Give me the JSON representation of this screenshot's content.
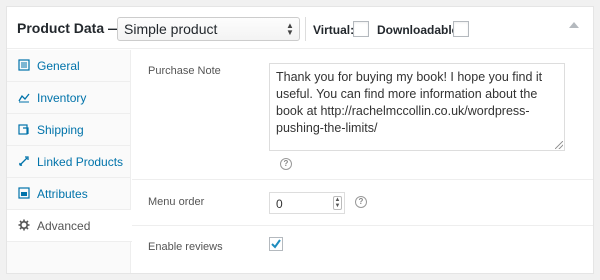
{
  "header": {
    "title": "Product Data —",
    "product_type": "Simple product",
    "virtual_label": "Virtual:",
    "downloadable_label": "Downloadable:",
    "virtual_checked": false,
    "downloadable_checked": false
  },
  "sidebar": {
    "items": [
      {
        "label": "General",
        "icon": "general-icon",
        "active": false
      },
      {
        "label": "Inventory",
        "icon": "inventory-icon",
        "active": false
      },
      {
        "label": "Shipping",
        "icon": "shipping-icon",
        "active": false
      },
      {
        "label": "Linked Products",
        "icon": "linked-products-icon",
        "active": false
      },
      {
        "label": "Attributes",
        "icon": "attributes-icon",
        "active": false
      },
      {
        "label": "Advanced",
        "icon": "advanced-icon",
        "active": true
      }
    ]
  },
  "fields": {
    "purchase_note_label": "Purchase Note",
    "purchase_note_value": "Thank you for buying my book! I hope you find it useful. You can find more information about the book at http://rachelmccollin.co.uk/wordpress-pushing-the-limits/",
    "menu_order_label": "Menu order",
    "menu_order_value": "0",
    "enable_reviews_label": "Enable reviews",
    "enable_reviews_checked": true
  },
  "colors": {
    "link": "#0073aa",
    "checkmark": "#1e8cbe",
    "active_text": "#555555"
  }
}
